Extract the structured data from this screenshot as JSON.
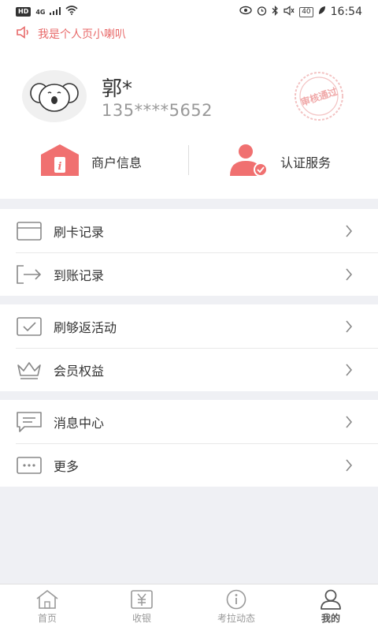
{
  "status_bar": {
    "hd": "HD",
    "signal": "4G",
    "battery": "40",
    "time": "16:54"
  },
  "notice": {
    "text": "我是个人页小喇叭"
  },
  "profile": {
    "name": "郭*",
    "phone": "135****5652",
    "stamp": "审核通过"
  },
  "quick_actions": [
    {
      "label": "商户信息"
    },
    {
      "label": "认证服务"
    }
  ],
  "menu": {
    "groups": [
      {
        "items": [
          {
            "label": "刷卡记录"
          },
          {
            "label": "到账记录"
          }
        ]
      },
      {
        "items": [
          {
            "label": "刷够返活动"
          },
          {
            "label": "会员权益"
          }
        ]
      },
      {
        "items": [
          {
            "label": "消息中心"
          },
          {
            "label": "更多"
          }
        ]
      }
    ]
  },
  "tabbar": {
    "tabs": [
      {
        "label": "首页"
      },
      {
        "label": "收银"
      },
      {
        "label": "考拉动态"
      },
      {
        "label": "我的"
      }
    ],
    "active": "我的"
  },
  "colors": {
    "accent": "#e86a6a",
    "icon_red": "#f07070",
    "background": "#eff0f4"
  }
}
